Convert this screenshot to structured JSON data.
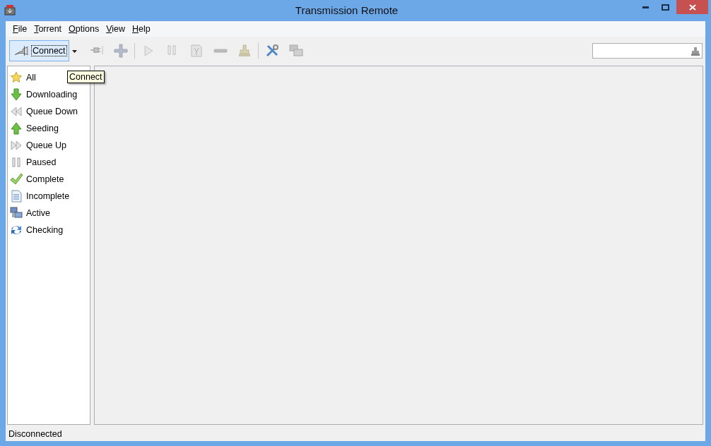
{
  "window": {
    "title": "Transmission Remote"
  },
  "menu": [
    "File",
    "Torrent",
    "Options",
    "View",
    "Help"
  ],
  "toolbar": {
    "connect": {
      "label": "Connect",
      "focused": true
    },
    "groups": [
      [
        {
          "kind": "disconnect",
          "disabled": true
        },
        {
          "kind": "add",
          "disabled": true
        }
      ],
      [
        {
          "kind": "start",
          "disabled": true
        },
        {
          "kind": "pause",
          "disabled": true
        },
        {
          "kind": "properties",
          "disabled": true
        },
        {
          "kind": "remove",
          "disabled": true
        },
        {
          "kind": "move",
          "disabled": true
        }
      ],
      [
        {
          "kind": "settings",
          "disabled": false
        },
        {
          "kind": "windows",
          "disabled": true
        }
      ]
    ]
  },
  "tooltip": "Connect",
  "sidebar": {
    "items": [
      {
        "label": "All",
        "kind": "star"
      },
      {
        "label": "Downloading",
        "kind": "down"
      },
      {
        "label": "Queue Down",
        "kind": "queue-down"
      },
      {
        "label": "Seeding",
        "kind": "up"
      },
      {
        "label": "Queue Up",
        "kind": "queue-up"
      },
      {
        "label": "Paused",
        "kind": "pause"
      },
      {
        "label": "Complete",
        "kind": "check"
      },
      {
        "label": "Incomplete",
        "kind": "document"
      },
      {
        "label": "Active",
        "kind": "computers"
      },
      {
        "label": "Checking",
        "kind": "refresh"
      }
    ]
  },
  "status_bar": "Disconnected"
}
